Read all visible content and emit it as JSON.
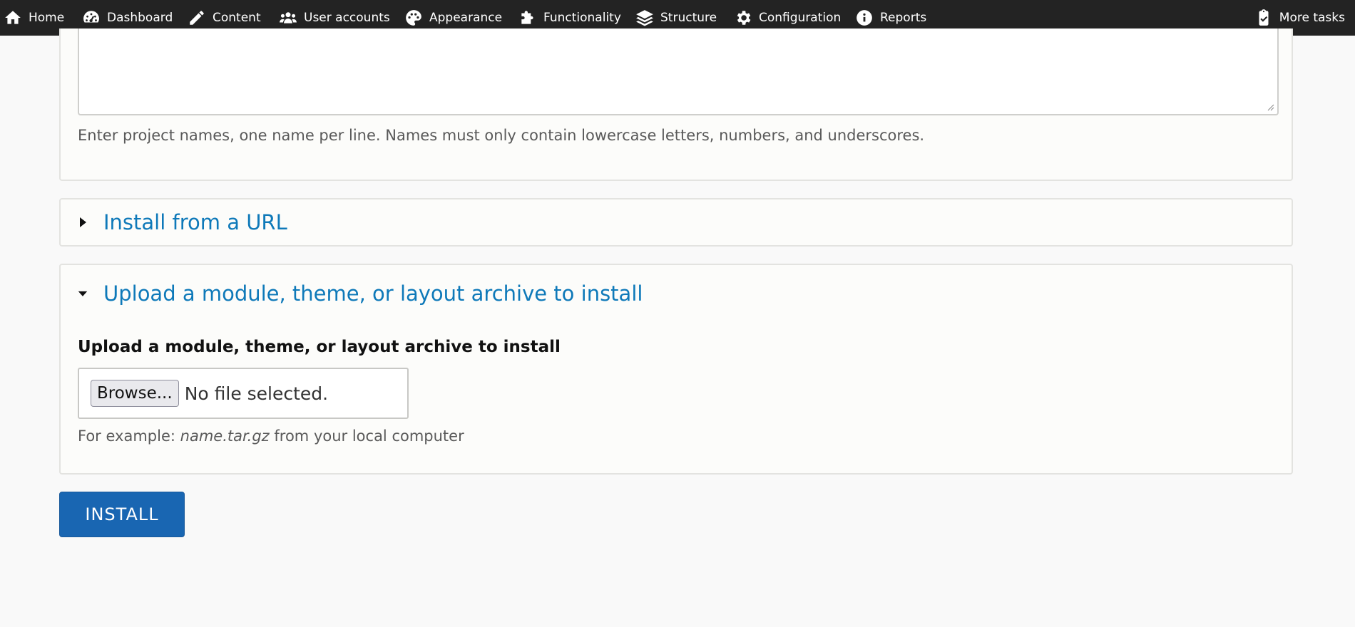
{
  "toolbar": {
    "items": [
      {
        "label": "Home",
        "icon": "home-icon"
      },
      {
        "label": "Dashboard",
        "icon": "dashboard-icon"
      },
      {
        "label": "Content",
        "icon": "pencil-icon"
      },
      {
        "label": "User accounts",
        "icon": "users-icon"
      },
      {
        "label": "Appearance",
        "icon": "palette-icon"
      },
      {
        "label": "Functionality",
        "icon": "puzzle-icon"
      },
      {
        "label": "Structure",
        "icon": "layers-icon"
      },
      {
        "label": "Configuration",
        "icon": "gear-icon"
      },
      {
        "label": "Reports",
        "icon": "info-icon"
      }
    ],
    "more_tasks": {
      "label": "More tasks",
      "icon": "clipboard-check-icon"
    }
  },
  "projects": {
    "textarea_value": "",
    "help": "Enter project names, one name per line. Names must only contain lowercase letters, numbers, and underscores."
  },
  "url_section": {
    "summary": "Install from a URL",
    "expanded": false
  },
  "upload_section": {
    "summary": "Upload a module, theme, or layout archive to install",
    "expanded": true,
    "field_label": "Upload a module, theme, or layout archive to install",
    "browse_label": "Browse...",
    "no_file_text": "No file selected.",
    "help_prefix": "For example: ",
    "help_example": "name.tar.gz",
    "help_suffix": " from your local computer"
  },
  "actions": {
    "install_label": "INSTALL"
  },
  "colors": {
    "toolbar_bg": "#232323",
    "link": "#0e79b9",
    "primary_button": "#1966b2",
    "page_bg": "#f9f9f9"
  }
}
